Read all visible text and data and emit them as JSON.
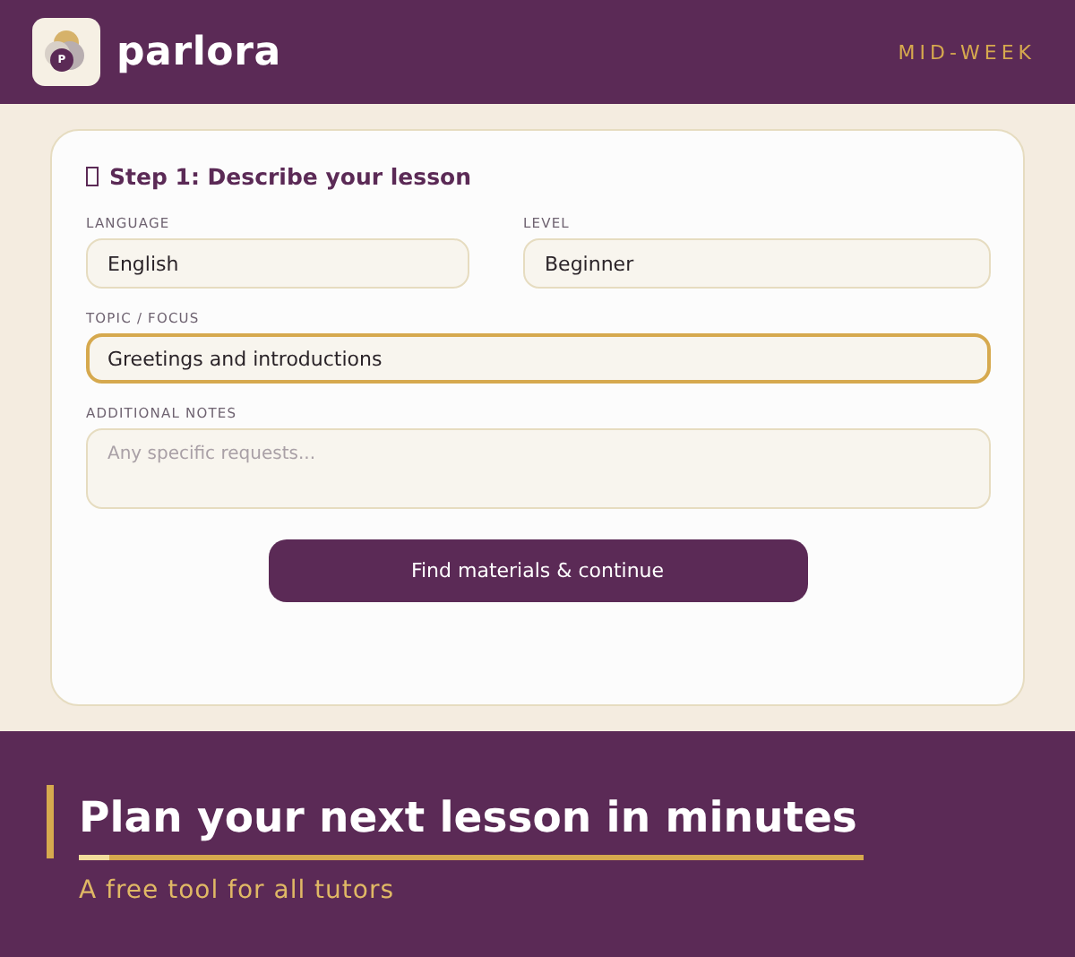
{
  "header": {
    "logo_mark": "P",
    "brand": "parlora",
    "tag": "MID-WEEK"
  },
  "card": {
    "title": "Step 1: Describe your lesson",
    "fields": [
      {
        "label": "LANGUAGE",
        "value": "English",
        "kind": "input",
        "focused": false
      },
      {
        "label": "LEVEL",
        "value": "Beginner",
        "kind": "input",
        "focused": false
      },
      {
        "label": "TOPIC / FOCUS",
        "value": "Greetings and introductions",
        "kind": "input",
        "focused": true
      },
      {
        "label": "ADDITIONAL NOTES",
        "placeholder": "Any specific requests...",
        "kind": "textarea",
        "focused": false
      }
    ],
    "button": "Find materials & continue"
  },
  "hero": {
    "title": "Plan your next lesson in minutes",
    "subtitle": "A free tool for all tutors"
  }
}
